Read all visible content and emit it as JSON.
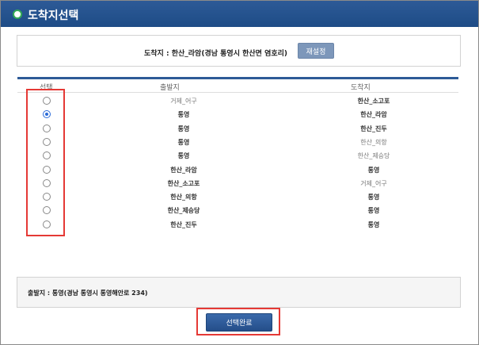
{
  "window": {
    "title": "도착지선택"
  },
  "destination": {
    "text": "도착지 : 한산_라암(경남 통영시 한산면 염호리)",
    "reset_label": "재설정"
  },
  "table": {
    "headers": {
      "select": "선택",
      "departure": "출발지",
      "arrival": "도착지"
    },
    "rows": [
      {
        "departure": "거제_어구",
        "arrival": "한산_소고포",
        "selected": false
      },
      {
        "departure": "통영",
        "arrival": "한산_라암",
        "selected": true
      },
      {
        "departure": "통영",
        "arrival": "한산_진두",
        "selected": false
      },
      {
        "departure": "통영",
        "arrival": "한산_의항",
        "selected": false
      },
      {
        "departure": "통영",
        "arrival": "한산_제승당",
        "selected": false
      },
      {
        "departure": "한산_라암",
        "arrival": "통영",
        "selected": false
      },
      {
        "departure": "한산_소고포",
        "arrival": "거제_어구",
        "selected": false
      },
      {
        "departure": "한산_의항",
        "arrival": "통영",
        "selected": false
      },
      {
        "departure": "한산_제승당",
        "arrival": "통영",
        "selected": false
      },
      {
        "departure": "한산_진두",
        "arrival": "통영",
        "selected": false
      }
    ]
  },
  "origin": {
    "text": "출발지 : 통영(경남 통영시 통영해안로 234)"
  },
  "actions": {
    "confirm_label": "선택완료"
  },
  "colors": {
    "titlebar": "#1e4c86",
    "highlight": "#e53935",
    "accent": "#2a6ad8"
  }
}
